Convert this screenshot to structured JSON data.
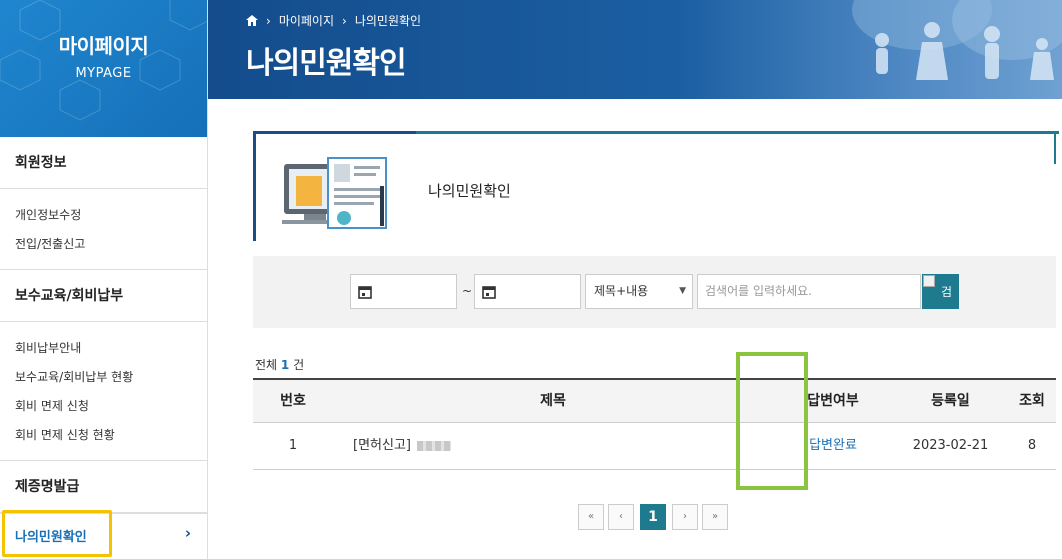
{
  "sidebar": {
    "title": "마이페이지",
    "subtitle": "MYPAGE",
    "groups": [
      {
        "title": "회원정보",
        "items": [
          "개인정보수정",
          "전입/전출신고"
        ]
      },
      {
        "title": "보수교육/회비납부",
        "items": [
          "회비납부안내",
          "보수교육/회비납부 현황",
          "회비 면제 신청",
          "회비 면제 신청 현황"
        ]
      },
      {
        "title": "제증명발급",
        "items": []
      }
    ],
    "active_item": "나의민원확인",
    "active_chevron": "›"
  },
  "banner": {
    "breadcrumb": [
      "마이페이지",
      "나의민원확인"
    ],
    "separator": "›",
    "title": "나의민원확인"
  },
  "info": {
    "title": "나의민원확인"
  },
  "search": {
    "date_from": "",
    "date_to": "",
    "tilde": "~",
    "select_value": "제목+내용",
    "keyword_placeholder": "검색어를 입력하세요.",
    "button_label": "검"
  },
  "count": {
    "prefix": "전체",
    "num": "1",
    "suffix": "건"
  },
  "table": {
    "headers": [
      "번호",
      "제목",
      "답변여부",
      "등록일",
      "조회"
    ],
    "rows": [
      {
        "no": "1",
        "title": "[면허신고]",
        "answer": "답변완료",
        "date": "2023-02-21",
        "views": "8"
      }
    ]
  },
  "pagination": {
    "first": "«",
    "prev": "‹",
    "current": "1",
    "next": "›",
    "last": "»"
  },
  "colors": {
    "sidebar_blue": "#1f86cf",
    "banner_navy": "#144c8c",
    "teal": "#1e7a8e",
    "highlight_yellow": "#f5c300",
    "highlight_green": "#8bc540",
    "link_blue": "#1a6fb5"
  }
}
